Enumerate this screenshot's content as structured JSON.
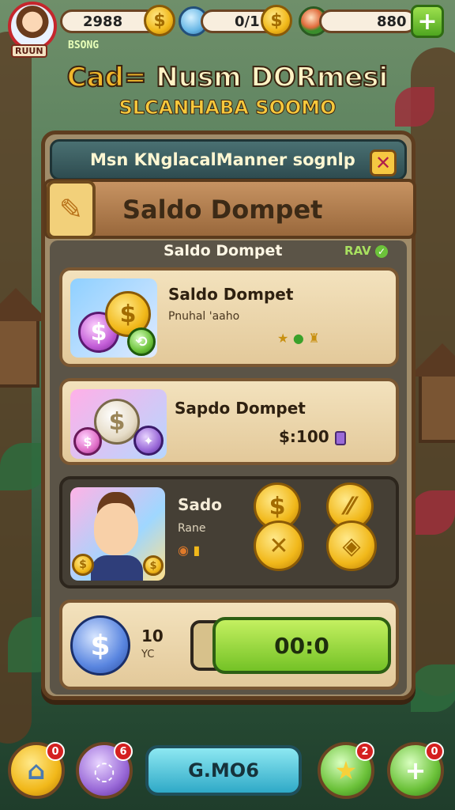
{
  "hud": {
    "avatar_label": "RUUN",
    "res1_value": "2988",
    "res2_value": "0/1",
    "res3_value": "880",
    "sub_label": "BSONG"
  },
  "titles": {
    "line1_a": "Cad=",
    "line1_b": " Nusm DORmesi",
    "line2": "SLCANHABA SOOMO"
  },
  "panel": {
    "header": "Msn KNglacalManner sognlp",
    "banner_title": "Saldo Dompet",
    "section_title": "Saldo Dompet",
    "section_badge": "RAV"
  },
  "cards": [
    {
      "title": "Saldo Dompet",
      "sub": "Pnuhal 'aaho"
    },
    {
      "title": "Sapdo Dompet",
      "price": "$:100"
    },
    {
      "title": "Sado",
      "sub": "Rane"
    },
    {
      "small_value": "10",
      "small_sub": "YC",
      "button_label": "00:0"
    }
  ],
  "bottom": {
    "badge1": "0",
    "badge2": "6",
    "center_label": "G.MO6",
    "badge4": "2",
    "badge5": "0"
  }
}
